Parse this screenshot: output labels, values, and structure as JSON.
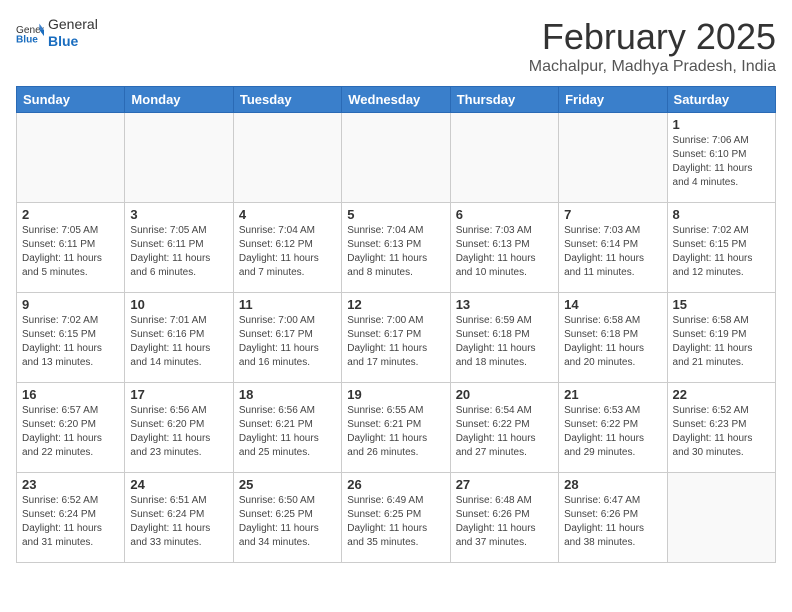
{
  "header": {
    "logo_general": "General",
    "logo_blue": "Blue",
    "title": "February 2025",
    "subtitle": "Machalpur, Madhya Pradesh, India"
  },
  "calendar": {
    "days_of_week": [
      "Sunday",
      "Monday",
      "Tuesday",
      "Wednesday",
      "Thursday",
      "Friday",
      "Saturday"
    ],
    "weeks": [
      [
        {
          "day": "",
          "info": ""
        },
        {
          "day": "",
          "info": ""
        },
        {
          "day": "",
          "info": ""
        },
        {
          "day": "",
          "info": ""
        },
        {
          "day": "",
          "info": ""
        },
        {
          "day": "",
          "info": ""
        },
        {
          "day": "1",
          "info": "Sunrise: 7:06 AM\nSunset: 6:10 PM\nDaylight: 11 hours and 4 minutes."
        }
      ],
      [
        {
          "day": "2",
          "info": "Sunrise: 7:05 AM\nSunset: 6:11 PM\nDaylight: 11 hours and 5 minutes."
        },
        {
          "day": "3",
          "info": "Sunrise: 7:05 AM\nSunset: 6:11 PM\nDaylight: 11 hours and 6 minutes."
        },
        {
          "day": "4",
          "info": "Sunrise: 7:04 AM\nSunset: 6:12 PM\nDaylight: 11 hours and 7 minutes."
        },
        {
          "day": "5",
          "info": "Sunrise: 7:04 AM\nSunset: 6:13 PM\nDaylight: 11 hours and 8 minutes."
        },
        {
          "day": "6",
          "info": "Sunrise: 7:03 AM\nSunset: 6:13 PM\nDaylight: 11 hours and 10 minutes."
        },
        {
          "day": "7",
          "info": "Sunrise: 7:03 AM\nSunset: 6:14 PM\nDaylight: 11 hours and 11 minutes."
        },
        {
          "day": "8",
          "info": "Sunrise: 7:02 AM\nSunset: 6:15 PM\nDaylight: 11 hours and 12 minutes."
        }
      ],
      [
        {
          "day": "9",
          "info": "Sunrise: 7:02 AM\nSunset: 6:15 PM\nDaylight: 11 hours and 13 minutes."
        },
        {
          "day": "10",
          "info": "Sunrise: 7:01 AM\nSunset: 6:16 PM\nDaylight: 11 hours and 14 minutes."
        },
        {
          "day": "11",
          "info": "Sunrise: 7:00 AM\nSunset: 6:17 PM\nDaylight: 11 hours and 16 minutes."
        },
        {
          "day": "12",
          "info": "Sunrise: 7:00 AM\nSunset: 6:17 PM\nDaylight: 11 hours and 17 minutes."
        },
        {
          "day": "13",
          "info": "Sunrise: 6:59 AM\nSunset: 6:18 PM\nDaylight: 11 hours and 18 minutes."
        },
        {
          "day": "14",
          "info": "Sunrise: 6:58 AM\nSunset: 6:18 PM\nDaylight: 11 hours and 20 minutes."
        },
        {
          "day": "15",
          "info": "Sunrise: 6:58 AM\nSunset: 6:19 PM\nDaylight: 11 hours and 21 minutes."
        }
      ],
      [
        {
          "day": "16",
          "info": "Sunrise: 6:57 AM\nSunset: 6:20 PM\nDaylight: 11 hours and 22 minutes."
        },
        {
          "day": "17",
          "info": "Sunrise: 6:56 AM\nSunset: 6:20 PM\nDaylight: 11 hours and 23 minutes."
        },
        {
          "day": "18",
          "info": "Sunrise: 6:56 AM\nSunset: 6:21 PM\nDaylight: 11 hours and 25 minutes."
        },
        {
          "day": "19",
          "info": "Sunrise: 6:55 AM\nSunset: 6:21 PM\nDaylight: 11 hours and 26 minutes."
        },
        {
          "day": "20",
          "info": "Sunrise: 6:54 AM\nSunset: 6:22 PM\nDaylight: 11 hours and 27 minutes."
        },
        {
          "day": "21",
          "info": "Sunrise: 6:53 AM\nSunset: 6:22 PM\nDaylight: 11 hours and 29 minutes."
        },
        {
          "day": "22",
          "info": "Sunrise: 6:52 AM\nSunset: 6:23 PM\nDaylight: 11 hours and 30 minutes."
        }
      ],
      [
        {
          "day": "23",
          "info": "Sunrise: 6:52 AM\nSunset: 6:24 PM\nDaylight: 11 hours and 31 minutes."
        },
        {
          "day": "24",
          "info": "Sunrise: 6:51 AM\nSunset: 6:24 PM\nDaylight: 11 hours and 33 minutes."
        },
        {
          "day": "25",
          "info": "Sunrise: 6:50 AM\nSunset: 6:25 PM\nDaylight: 11 hours and 34 minutes."
        },
        {
          "day": "26",
          "info": "Sunrise: 6:49 AM\nSunset: 6:25 PM\nDaylight: 11 hours and 35 minutes."
        },
        {
          "day": "27",
          "info": "Sunrise: 6:48 AM\nSunset: 6:26 PM\nDaylight: 11 hours and 37 minutes."
        },
        {
          "day": "28",
          "info": "Sunrise: 6:47 AM\nSunset: 6:26 PM\nDaylight: 11 hours and 38 minutes."
        },
        {
          "day": "",
          "info": ""
        }
      ]
    ]
  }
}
